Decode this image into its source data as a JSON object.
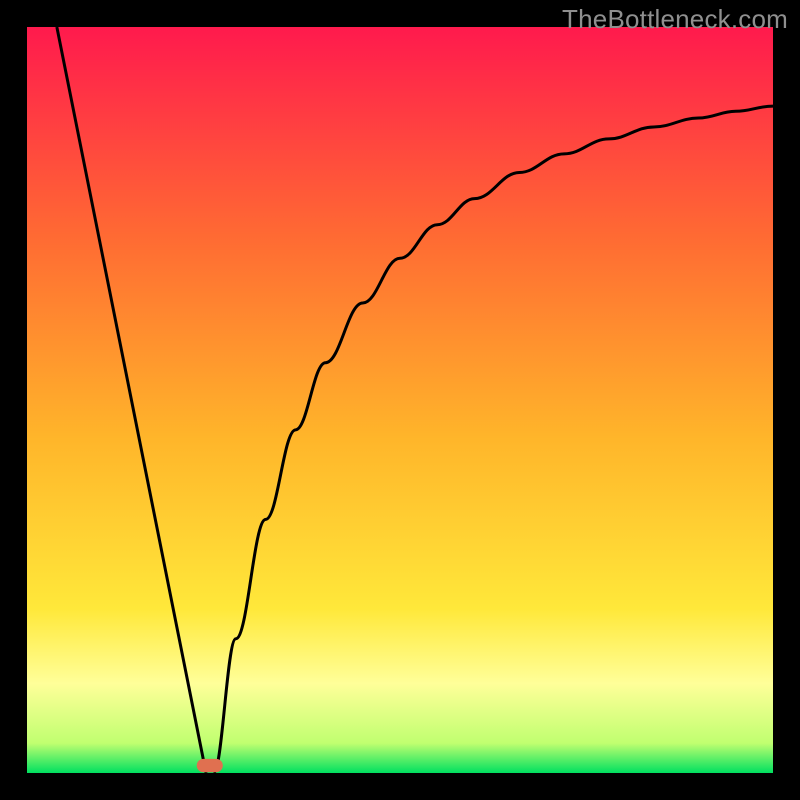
{
  "watermark": "TheBottleneck.com",
  "colors": {
    "black": "#000000",
    "red_top": "#ff1a4d",
    "orange": "#ff8a2a",
    "yellow": "#ffe83a",
    "pale_yellow": "#ffff99",
    "green_bottom": "#00e060",
    "curve": "#000000",
    "marker": "#e07050"
  },
  "chart_data": {
    "type": "line",
    "title": "",
    "xlabel": "",
    "ylabel": "",
    "xlim": [
      0,
      100
    ],
    "ylim": [
      0,
      100
    ],
    "background_gradient": {
      "direction": "vertical",
      "stops": [
        {
          "pos": 0.0,
          "color": "#ff1a4d"
        },
        {
          "pos": 0.28,
          "color": "#ff6a33"
        },
        {
          "pos": 0.55,
          "color": "#ffb52a"
        },
        {
          "pos": 0.78,
          "color": "#ffe83a"
        },
        {
          "pos": 0.88,
          "color": "#ffff99"
        },
        {
          "pos": 0.96,
          "color": "#c0ff70"
        },
        {
          "pos": 1.0,
          "color": "#00e060"
        }
      ]
    },
    "series": [
      {
        "name": "left-linear",
        "segment": "line",
        "x": [
          4,
          24
        ],
        "y": [
          100,
          0
        ]
      },
      {
        "name": "right-curve",
        "segment": "curve",
        "x": [
          25,
          28,
          32,
          36,
          40,
          45,
          50,
          55,
          60,
          66,
          72,
          78,
          84,
          90,
          95,
          100
        ],
        "y": [
          0,
          18,
          34,
          46,
          55,
          63,
          69,
          73.5,
          77,
          80.5,
          83,
          85,
          86.6,
          87.8,
          88.7,
          89.4
        ]
      }
    ],
    "marker": {
      "x": 24.5,
      "y": 1.0,
      "w": 3.5,
      "h": 1.8
    }
  }
}
